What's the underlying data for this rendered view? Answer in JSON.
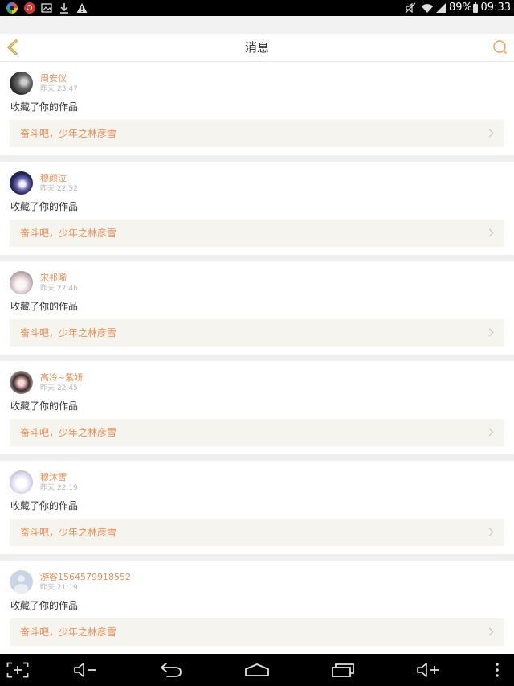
{
  "status_bar": {
    "notification_icons": [
      "app-notification-icon",
      "app-notification-icon",
      "image-icon",
      "download-icon",
      "warning-icon"
    ],
    "system_icons": [
      "mute-icon",
      "wifi-icon",
      "signal-icon",
      "battery-icon"
    ],
    "battery_level": "89%",
    "clock": "09:33"
  },
  "header": {
    "back_icon": "chevron-left-icon",
    "title": "消息",
    "search_icon": "search-icon"
  },
  "messages": [
    {
      "user_name": "周安仪",
      "timestamp": "昨天 23:47",
      "action": "收藏了你的作品",
      "work_title": "奋斗吧，少年之林彦雪"
    },
    {
      "user_name": "穆颜泣",
      "timestamp": "昨天 22:52",
      "action": "收藏了你的作品",
      "work_title": "奋斗吧，少年之林彦雪"
    },
    {
      "user_name": "宋祁晞",
      "timestamp": "昨天 22:46",
      "action": "收藏了你的作品",
      "work_title": "奋斗吧，少年之林彦雪"
    },
    {
      "user_name": "高冷~紫妍",
      "timestamp": "昨天 22:45",
      "action": "收藏了你的作品",
      "work_title": "奋斗吧，少年之林彦雪"
    },
    {
      "user_name": "穆沐雪",
      "timestamp": "昨天 22:19",
      "action": "收藏了你的作品",
      "work_title": "奋斗吧，少年之林彦雪"
    },
    {
      "user_name": "游客1564579918552",
      "timestamp": "昨天 21:19",
      "action": "收藏了你的作品",
      "work_title": "奋斗吧，少年之林彦雪"
    }
  ],
  "nav_bar": {
    "icons": [
      "screenshot-icon",
      "volume-down-icon",
      "back-icon",
      "home-icon",
      "recent-apps-icon",
      "volume-up-icon",
      "menu-icon"
    ]
  },
  "colors": {
    "accent": "#ee8e54",
    "back_icon": "#c9a23c",
    "search_icon": "#f0a25a",
    "work_card_background": "#f5f4ee",
    "page_background": "#efefef"
  }
}
